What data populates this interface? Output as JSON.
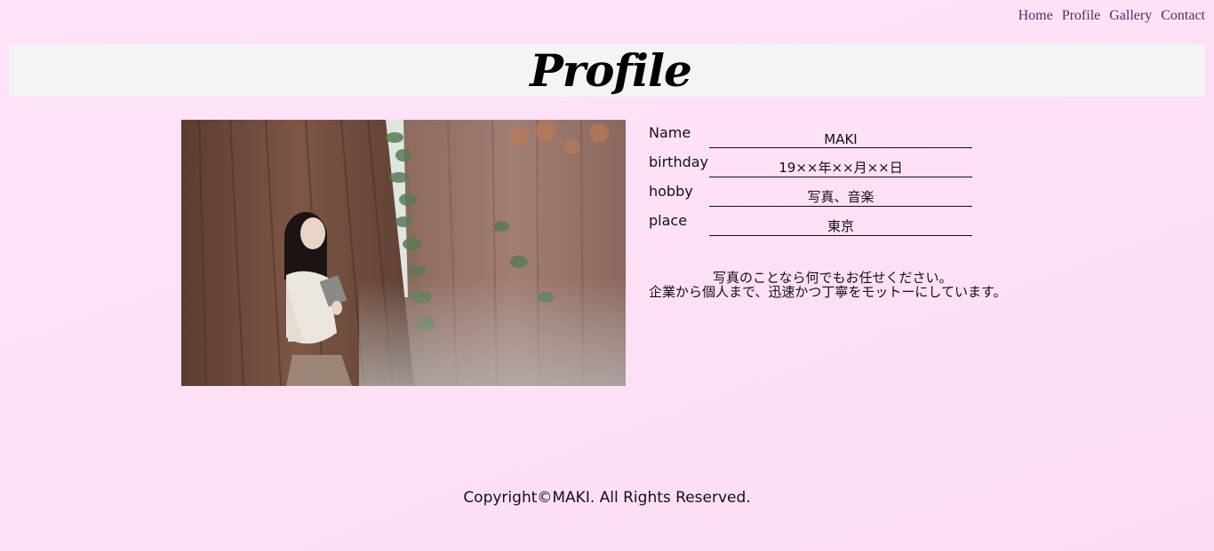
{
  "nav": {
    "items": [
      {
        "label": "Home"
      },
      {
        "label": "Profile"
      },
      {
        "label": "Gallery"
      },
      {
        "label": "Contact"
      }
    ],
    "color": "#4b2e68"
  },
  "page": {
    "title": "Profile",
    "background": "#ffe3f9",
    "title_band_color": "#f4f4f4"
  },
  "profile": {
    "fields": [
      {
        "label": "Name",
        "value": "MAKI"
      },
      {
        "label": "birthday",
        "value": "19××年××月××日"
      },
      {
        "label": "hobby",
        "value": "写真、音楽"
      },
      {
        "label": "place",
        "value": "東京"
      }
    ],
    "description": [
      "写真のことなら何でもお任せください。",
      "企業から個人まで、迅速かつ丁寧をモットーにしています。"
    ]
  },
  "footer": {
    "copyright": "Copyright©MAKI. All Rights Reserved."
  }
}
